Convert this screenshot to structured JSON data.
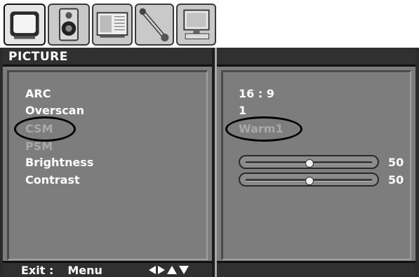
{
  "tabs": [
    {
      "icon": "tv-icon",
      "active": true
    },
    {
      "icon": "speaker-icon",
      "active": false
    },
    {
      "icon": "clock-icon",
      "active": false
    },
    {
      "icon": "wrench-icon",
      "active": false
    },
    {
      "icon": "pc-monitor-icon",
      "active": false
    }
  ],
  "header": {
    "title": "PICTURE"
  },
  "menu": [
    {
      "label": "ARC",
      "value": "16 : 9"
    },
    {
      "label": "Overscan",
      "value": "1"
    },
    {
      "label": "CSM",
      "value": "Warm1"
    },
    {
      "label": "PSM",
      "value": ""
    },
    {
      "label": "Brightness",
      "value": "50",
      "level": 50
    },
    {
      "label": "Contrast",
      "value": "50",
      "level": 50
    }
  ],
  "footer": {
    "exit_label": "Exit :",
    "key_label": "Menu",
    "nav_icons": [
      "arrow-left-icon",
      "arrow-right-icon",
      "arrow-up-icon",
      "arrow-down-icon"
    ]
  },
  "colors": {
    "panel": "#7d7d7d",
    "bar": "#303030",
    "text": "#ffffff",
    "disabled_text": "#a9a9a9"
  }
}
